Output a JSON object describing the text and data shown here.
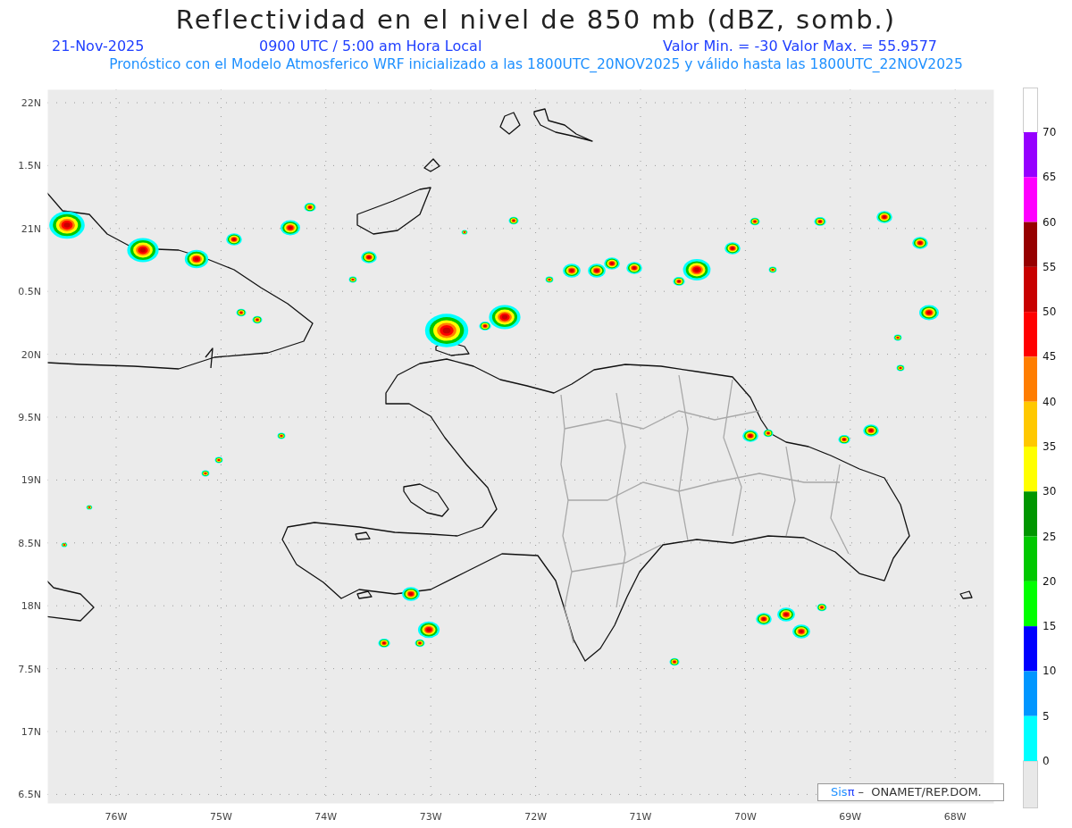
{
  "title": "Reflectividad en el nivel de 850 mb (dBZ, somb.)",
  "info": {
    "date": "21-Nov-2025",
    "time": "0900 UTC / 5:00 am Hora Local",
    "range": "Valor Min. = -30  Valor Max. = 55.9577"
  },
  "subtitle": "Pronóstico con el Modelo Atmosferico WRF inicializado a las 1800UTC_20NOV2025 y válido hasta las  1800UTC_22NOV2025",
  "map": {
    "lat_labels": [
      "22N",
      "1.5N",
      "21N",
      "0.5N",
      "20N",
      "9.5N",
      "19N",
      "8.5N",
      "18N",
      "7.5N",
      "17N",
      "6.5N"
    ],
    "lon_labels": [
      "76W",
      "75W",
      "74W",
      "73W",
      "72W",
      "71W",
      "70W",
      "69W",
      "68W"
    ],
    "credit": [
      {
        "text": "Sis",
        "kind": "light"
      },
      {
        "text": "π",
        "kind": "dark"
      },
      {
        "text": " –  ONAMET/REP.DOM.",
        "kind": "plain"
      }
    ]
  },
  "colorbar": {
    "bins": [
      {
        "color": "#9600ff"
      },
      {
        "color": "#ff00ff"
      },
      {
        "color": "#960000"
      },
      {
        "color": "#c80000"
      },
      {
        "color": "#ff0000"
      },
      {
        "color": "#ff7d00"
      },
      {
        "color": "#ffc800"
      },
      {
        "color": "#ffff00"
      },
      {
        "color": "#009600"
      },
      {
        "color": "#00c800"
      },
      {
        "color": "#00ff00"
      },
      {
        "color": "#0000ff"
      },
      {
        "color": "#0096ff"
      },
      {
        "color": "#00ffff"
      }
    ],
    "labels": [
      "70",
      "65",
      "60",
      "55",
      "50",
      "45",
      "40",
      "35",
      "30",
      "25",
      "20",
      "15",
      "10",
      "5",
      "0"
    ]
  }
}
